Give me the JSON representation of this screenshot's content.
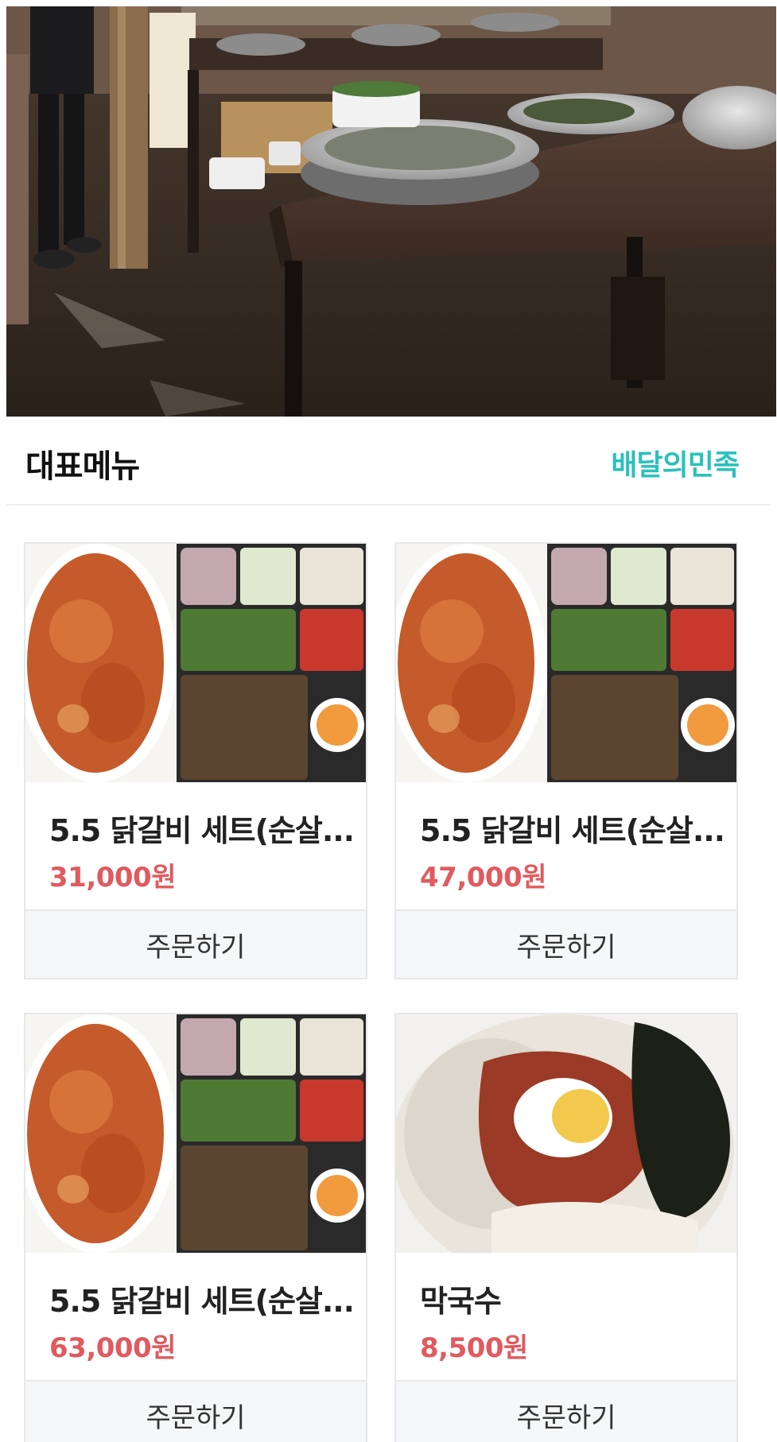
{
  "section": {
    "title": "대표메뉴",
    "brand_link": "배달의민족"
  },
  "colors": {
    "brand": "#2ac1bc",
    "price": "#e05a5e",
    "button_bg": "#f6f7f9"
  },
  "menu": [
    {
      "name": "5.5 닭갈비 세트(순살...",
      "price": "31,000원",
      "order_label": "주문하기",
      "image": "dakgalbi-set-photo"
    },
    {
      "name": "5.5 닭갈비 세트(순살...",
      "price": "47,000원",
      "order_label": "주문하기",
      "image": "dakgalbi-set-photo"
    },
    {
      "name": "5.5 닭갈비 세트(순살...",
      "price": "63,000원",
      "order_label": "주문하기",
      "image": "dakgalbi-set-photo"
    },
    {
      "name": "막국수",
      "price": "8,500원",
      "order_label": "주문하기",
      "image": "makguksu-photo"
    }
  ]
}
